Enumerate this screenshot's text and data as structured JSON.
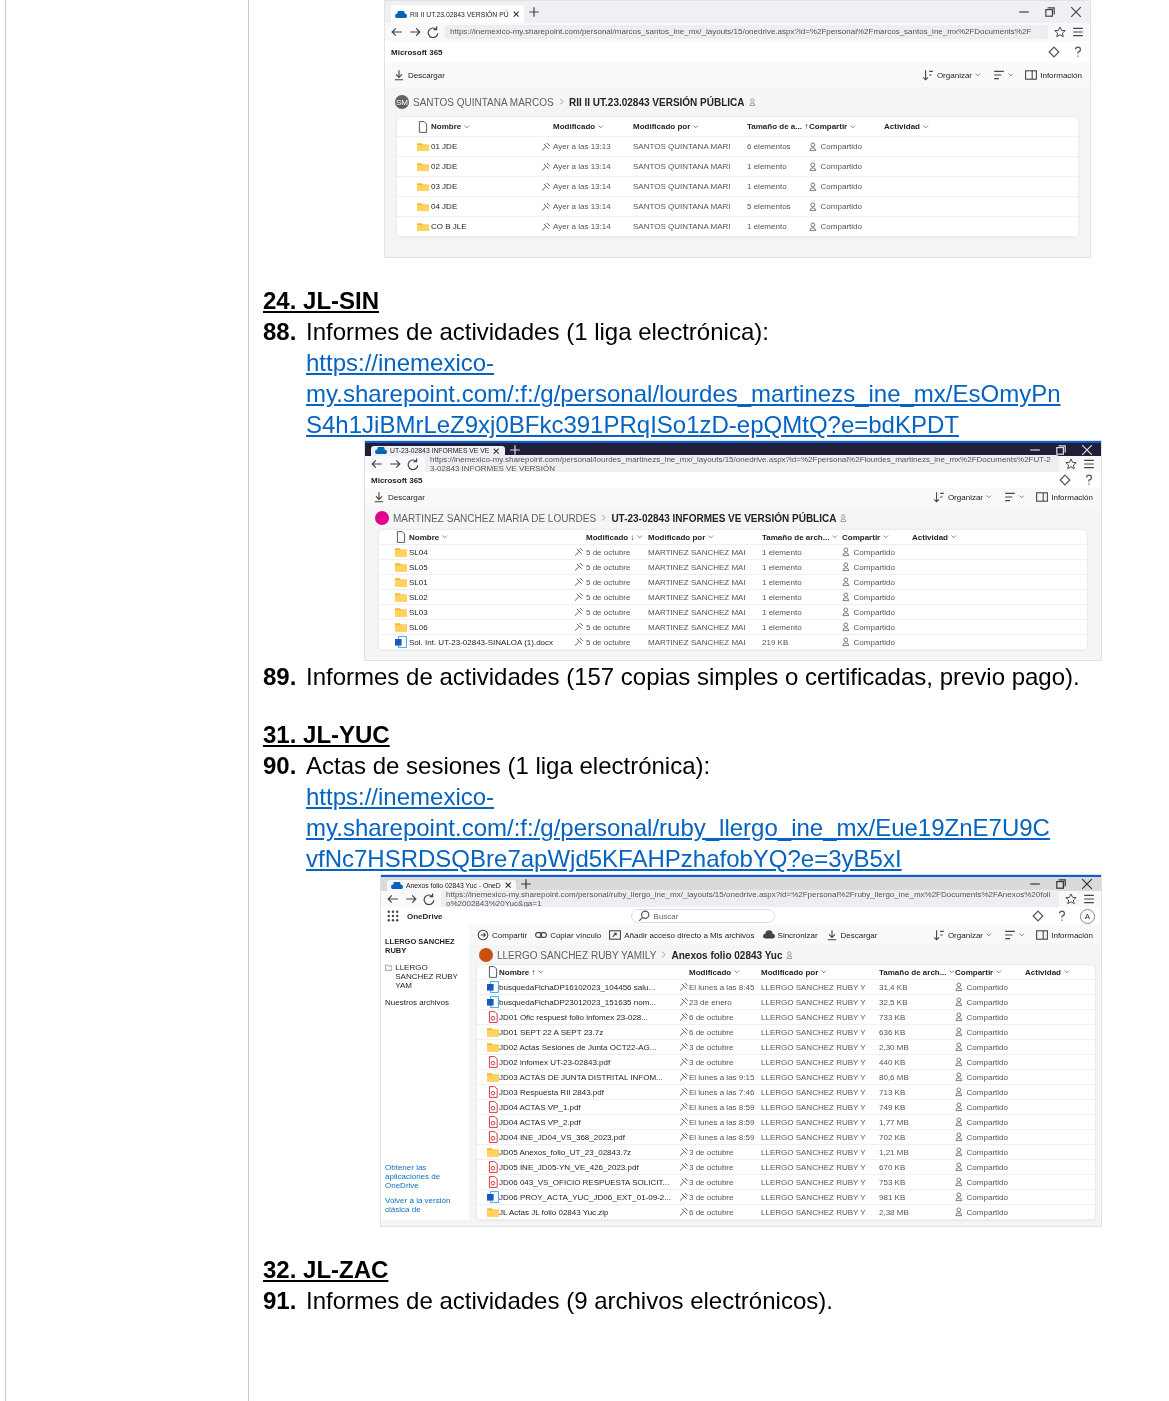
{
  "blocks": [
    {
      "kind": "screenshot-firefox",
      "tabs": [
        {
          "title": "RII II UT.23.02843 VERSIÓN PÚ",
          "selected": true
        }
      ],
      "url": "https://inemexico-my.sharepoint.com/personal/marcos_santos_ine_mx/_layouts/15/onedrive.aspx?id=%2Fpersonal%2Fmarcos_santos_ine_mx%2FDocuments%2F",
      "app": "Microsoft 365",
      "commands": [
        {
          "kind": "download",
          "label": "Descargar"
        }
      ],
      "right_commands": [
        {
          "kind": "sort",
          "label": "Organizar"
        },
        {
          "kind": "view"
        },
        {
          "kind": "info",
          "label": "Información"
        }
      ],
      "breadcrumb": {
        "initials": "SM",
        "color": "#616161",
        "owner": "SANTOS QUINTANA MARCOS",
        "folder": "RII II UT.23.02843 VERSIÓN PÚBLICA"
      },
      "columns": [
        "Nombre",
        "Modificado",
        "Modificado por",
        "Tamaño de a... ↑",
        "Compartir",
        "Actividad"
      ],
      "rows": [
        {
          "kind": "folder",
          "name": "01 JDE",
          "modified": "Ayer a las 13:13",
          "modified_by": "SANTOS QUINTANA MARI",
          "size": "6 elementos",
          "sharing": "Compartido"
        },
        {
          "kind": "folder",
          "name": "02 JDE",
          "modified": "Ayer a las 13:14",
          "modified_by": "SANTOS QUINTANA MARI",
          "size": "1 elemento",
          "sharing": "Compartido"
        },
        {
          "kind": "folder",
          "name": "03 JDE",
          "modified": "Ayer a las 13:14",
          "modified_by": "SANTOS QUINTANA MARI",
          "size": "1 elemento",
          "sharing": "Compartido"
        },
        {
          "kind": "folder",
          "name": "04 JDE",
          "modified": "Ayer a las 13:14",
          "modified_by": "SANTOS QUINTANA MARI",
          "size": "5 elementos",
          "sharing": "Compartido"
        },
        {
          "kind": "folder",
          "name": "CO B JLE",
          "modified": "Ayer a las 13:14",
          "modified_by": "SANTOS QUINTANA MARI",
          "size": "1 elemento",
          "sharing": "Compartido"
        }
      ]
    },
    {
      "kind": "heading",
      "text": "24. JL-SIN"
    },
    {
      "kind": "item",
      "number": "88.",
      "text": "Informes de actividades (1 liga electrónica):",
      "link_lines": [
        "https://inemexico-",
        "my.sharepoint.com/:f:/g/personal/lourdes_martinezs_ine_mx/EsOmyPn",
        "S4h1JiBMrLeZ9xj0BFkc391PRqISo1zD-epQMtQ?e=bdKPDT"
      ]
    },
    {
      "kind": "screenshot-firefox-dark",
      "tabs": [
        {
          "title": "UT-23-02843 INFORMES VE VE",
          "selected": true
        }
      ],
      "url": "https://inemexico-my.sharepoint.com/personal/lourdes_martinezs_ine_mx/_layouts/15/onedrive.aspx?id=%2Fpersonal%2Flourdes_martinezs_ine_mx%2FDocuments%2FUT-23-02843 INFORMES VE VERSIÓN",
      "app": "Microsoft 365",
      "commands": [
        {
          "kind": "download",
          "label": "Descargar"
        }
      ],
      "right_commands": [
        {
          "kind": "sort",
          "label": "Organizar"
        },
        {
          "kind": "view"
        },
        {
          "kind": "info",
          "label": "Información"
        }
      ],
      "breadcrumb": {
        "color": "#e3008c",
        "owner": "MARTINEZ SANCHEZ MARIA DE LOURDES",
        "folder": "UT-23-02843 INFORMES VE VERSIÓN PÚBLICA"
      },
      "columns": [
        "Nombre",
        "Modificado ↓",
        "Modificado por",
        "Tamaño de arch...",
        "Compartir",
        "Actividad"
      ],
      "rows": [
        {
          "kind": "folder",
          "name": "SL04",
          "modified": "5 de octubre",
          "modified_by": "MARTINEZ SANCHEZ MAI",
          "size": "1 elemento",
          "sharing": "Compartido"
        },
        {
          "kind": "folder",
          "name": "SL05",
          "modified": "5 de octubre",
          "modified_by": "MARTINEZ SANCHEZ MAI",
          "size": "1 elemento",
          "sharing": "Compartido"
        },
        {
          "kind": "folder",
          "name": "SL01",
          "modified": "5 de octubre",
          "modified_by": "MARTINEZ SANCHEZ MAI",
          "size": "1 elemento",
          "sharing": "Compartido"
        },
        {
          "kind": "folder",
          "name": "SL02",
          "modified": "5 de octubre",
          "modified_by": "MARTINEZ SANCHEZ MAI",
          "size": "1 elemento",
          "sharing": "Compartido"
        },
        {
          "kind": "folder",
          "name": "SL03",
          "modified": "5 de octubre",
          "modified_by": "MARTINEZ SANCHEZ MAI",
          "size": "1 elemento",
          "sharing": "Compartido"
        },
        {
          "kind": "folder",
          "name": "SL06",
          "modified": "5 de octubre",
          "modified_by": "MARTINEZ SANCHEZ MAI",
          "size": "1 elemento",
          "sharing": "Compartido"
        },
        {
          "kind": "word",
          "name": "Sol. Int. UT-23-02843-SINALOA (1).docx",
          "modified": "5 de octubre",
          "modified_by": "MARTINEZ SANCHEZ MAI",
          "size": "219 KB",
          "sharing": "Compartido"
        }
      ]
    },
    {
      "kind": "item",
      "number": "89.",
      "text": "Informes de actividades (157 copias simples o certificadas, previo pago)."
    },
    {
      "kind": "heading",
      "text": "31. JL-YUC"
    },
    {
      "kind": "item",
      "number": "90.",
      "text": "Actas de sesiones (1 liga electrónica):",
      "link_lines": [
        "https://inemexico-",
        "my.sharepoint.com/:f:/g/personal/ruby_llergo_ine_mx/Eue19ZnE7U9C",
        "vfNc7HSRDSQBre7apWjd5KFAHPzhafobYQ?e=3yB5xI"
      ]
    },
    {
      "kind": "screenshot-edge",
      "tabs": [
        {
          "title": "Anexos folio 02843 Yuc - OneD",
          "selected": true
        }
      ],
      "url": "https://inemexico-my.sharepoint.com/personal/ruby_llergo_ine_mx/_layouts/15/onedrive.aspx?id=%2Fpersonal%2Fruby_llergo_ine_mx%2FDocuments%2FAnexos%20folio%2002843%20Yuc&ga=1",
      "app": "OneDrive",
      "search_placeholder": "Buscar",
      "avatar": "A",
      "sidebar": {
        "account": "LLERGO SANCHEZ RUBY",
        "items": [
          {
            "kind": "folder",
            "label": "LLERGO SANCHEZ RUBY YAM"
          },
          {
            "kind": "plain",
            "label": "Nuestros archivos"
          }
        ],
        "footer_links": [
          "Obtener las aplicaciones de OneDrive",
          "Volver a la versión clásica de"
        ]
      },
      "commands": [
        {
          "kind": "share",
          "label": "Compartir"
        },
        {
          "kind": "link",
          "label": "Copiar vínculo"
        },
        {
          "kind": "shortcut",
          "label": "Añadir acceso directo a Mis archivos"
        },
        {
          "kind": "sync",
          "label": "Sincronizar"
        },
        {
          "kind": "download",
          "label": "Descargar"
        }
      ],
      "right_commands": [
        {
          "kind": "sort",
          "label": "Organizar"
        },
        {
          "kind": "view"
        },
        {
          "kind": "info",
          "label": "Información"
        }
      ],
      "breadcrumb": {
        "color": "#ca5010",
        "owner": "LLERGO SANCHEZ RUBY YAMILY",
        "folder": "Anexos folio 02843 Yuc"
      },
      "columns": [
        "Nombre ↑",
        "Modificado",
        "Modificado por",
        "Tamaño de arch...",
        "Compartir",
        "Actividad"
      ],
      "rows": [
        {
          "kind": "word",
          "name": "busquedaFichaDP16102023_104456 salu...",
          "modified": "El lunes a las 8:45",
          "modified_by": "LLERGO SANCHEZ RUBY Y",
          "size": "31,4 KB",
          "sharing": "Compartido"
        },
        {
          "kind": "word",
          "name": "busquedaFichaDP23012023_151635 nom...",
          "modified": "23 de enero",
          "modified_by": "LLERGO SANCHEZ RUBY Y",
          "size": "32,5 KB",
          "sharing": "Compartido"
        },
        {
          "kind": "pdf",
          "name": "JD01 Ofic  respuest folio infomex 23-028...",
          "modified": "6 de octubre",
          "modified_by": "LLERGO SANCHEZ RUBY Y",
          "size": "733 KB",
          "sharing": "Compartido"
        },
        {
          "kind": "folder",
          "name": "JD01 SEPT 22 A SEPT 23.7z",
          "modified": "6 de octubre",
          "modified_by": "LLERGO SANCHEZ RUBY Y",
          "size": "636 KB",
          "sharing": "Compartido"
        },
        {
          "kind": "folder",
          "name": "JD02 Actas Sesiones de Junta OCT22-AG...",
          "modified": "3 de octubre",
          "modified_by": "LLERGO SANCHEZ RUBY Y",
          "size": "2,30 MB",
          "sharing": "Compartido"
        },
        {
          "kind": "pdf",
          "name": "JD02 infomex UT-23-02843.pdf",
          "modified": "3 de octubre",
          "modified_by": "LLERGO SANCHEZ RUBY Y",
          "size": "440 KB",
          "sharing": "Compartido"
        },
        {
          "kind": "folder",
          "name": "JD03 ACTAS DE JUNTA DISTRITAL INFOM...",
          "modified": "El lunes a las 9:15",
          "modified_by": "LLERGO SANCHEZ RUBY Y",
          "size": "80,6 MB",
          "sharing": "Compartido"
        },
        {
          "kind": "pdf",
          "name": "JD03 Respuesta RII 2843.pdf",
          "modified": "El lunes a las 7:46",
          "modified_by": "LLERGO SANCHEZ RUBY Y",
          "size": "713 KB",
          "sharing": "Compartido"
        },
        {
          "kind": "pdf",
          "name": "JD04 ACTAS VP_1.pdf",
          "modified": "El lunes a las 8:59",
          "modified_by": "LLERGO SANCHEZ RUBY Y",
          "size": "749 KB",
          "sharing": "Compartido"
        },
        {
          "kind": "pdf",
          "name": "JD04 ACTAS VP_2.pdf",
          "modified": "El lunes a las 8:59",
          "modified_by": "LLERGO SANCHEZ RUBY Y",
          "size": "1,77 MB",
          "sharing": "Compartido"
        },
        {
          "kind": "pdf",
          "name": "JD04 INE_JD04_VS_368_2023.pdf",
          "modified": "El lunes a las 8:59",
          "modified_by": "LLERGO SANCHEZ RUBY Y",
          "size": "702 KB",
          "sharing": "Compartido"
        },
        {
          "kind": "folder",
          "name": "JD05 Anexos_folio_UT_23_02843.7z",
          "modified": "3 de octubre",
          "modified_by": "LLERGO SANCHEZ RUBY Y",
          "size": "1,21 MB",
          "sharing": "Compartido"
        },
        {
          "kind": "pdf",
          "name": "JD05 INE_JD05-YN_VE_426_2023.pdf",
          "modified": "3 de octubre",
          "modified_by": "LLERGO SANCHEZ RUBY Y",
          "size": "670 KB",
          "sharing": "Compartido"
        },
        {
          "kind": "pdf",
          "name": "JD06 043_VS_OFICIO RESPUESTA SOLICIT...",
          "modified": "3 de octubre",
          "modified_by": "LLERGO SANCHEZ RUBY Y",
          "size": "753 KB",
          "sharing": "Compartido"
        },
        {
          "kind": "word",
          "name": "JD06 PROY_ACTA_YUC_JD06_EXT_01-09-2...",
          "modified": "3 de octubre",
          "modified_by": "LLERGO SANCHEZ RUBY Y",
          "size": "981 KB",
          "sharing": "Compartido"
        },
        {
          "kind": "folder",
          "name": "JL Actas JL folio 02843 Yuc.zip",
          "modified": "6 de octubre",
          "modified_by": "LLERGO SANCHEZ RUBY Y",
          "size": "2,38 MB",
          "sharing": "Compartido"
        }
      ]
    },
    {
      "kind": "heading",
      "text": "32. JL-ZAC"
    },
    {
      "kind": "item",
      "number": "91.",
      "text": "Informes de actividades (9 archivos electrónicos)."
    }
  ]
}
